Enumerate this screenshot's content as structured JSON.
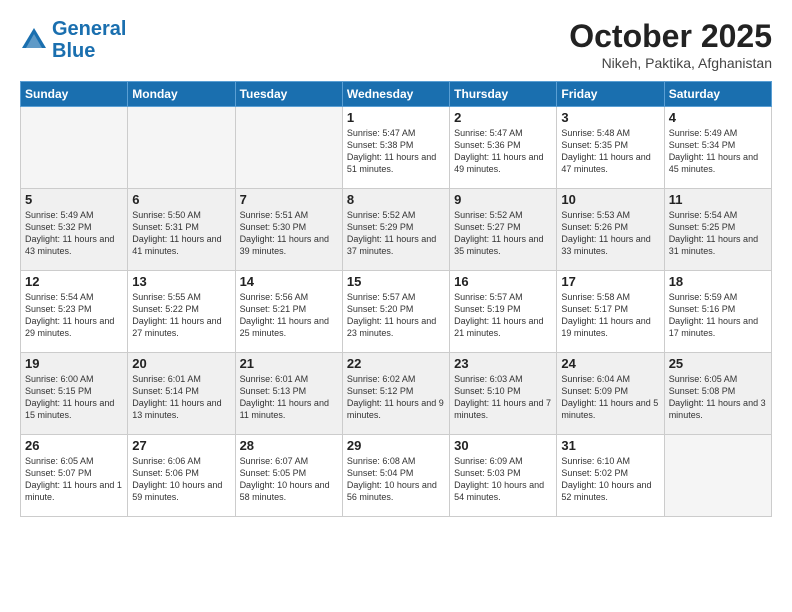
{
  "header": {
    "logo_line1": "General",
    "logo_line2": "Blue",
    "month": "October 2025",
    "location": "Nikeh, Paktika, Afghanistan"
  },
  "days_of_week": [
    "Sunday",
    "Monday",
    "Tuesday",
    "Wednesday",
    "Thursday",
    "Friday",
    "Saturday"
  ],
  "weeks": [
    [
      {
        "day": "",
        "text": ""
      },
      {
        "day": "",
        "text": ""
      },
      {
        "day": "",
        "text": ""
      },
      {
        "day": "1",
        "text": "Sunrise: 5:47 AM\nSunset: 5:38 PM\nDaylight: 11 hours\nand 51 minutes."
      },
      {
        "day": "2",
        "text": "Sunrise: 5:47 AM\nSunset: 5:36 PM\nDaylight: 11 hours\nand 49 minutes."
      },
      {
        "day": "3",
        "text": "Sunrise: 5:48 AM\nSunset: 5:35 PM\nDaylight: 11 hours\nand 47 minutes."
      },
      {
        "day": "4",
        "text": "Sunrise: 5:49 AM\nSunset: 5:34 PM\nDaylight: 11 hours\nand 45 minutes."
      }
    ],
    [
      {
        "day": "5",
        "text": "Sunrise: 5:49 AM\nSunset: 5:32 PM\nDaylight: 11 hours\nand 43 minutes."
      },
      {
        "day": "6",
        "text": "Sunrise: 5:50 AM\nSunset: 5:31 PM\nDaylight: 11 hours\nand 41 minutes."
      },
      {
        "day": "7",
        "text": "Sunrise: 5:51 AM\nSunset: 5:30 PM\nDaylight: 11 hours\nand 39 minutes."
      },
      {
        "day": "8",
        "text": "Sunrise: 5:52 AM\nSunset: 5:29 PM\nDaylight: 11 hours\nand 37 minutes."
      },
      {
        "day": "9",
        "text": "Sunrise: 5:52 AM\nSunset: 5:27 PM\nDaylight: 11 hours\nand 35 minutes."
      },
      {
        "day": "10",
        "text": "Sunrise: 5:53 AM\nSunset: 5:26 PM\nDaylight: 11 hours\nand 33 minutes."
      },
      {
        "day": "11",
        "text": "Sunrise: 5:54 AM\nSunset: 5:25 PM\nDaylight: 11 hours\nand 31 minutes."
      }
    ],
    [
      {
        "day": "12",
        "text": "Sunrise: 5:54 AM\nSunset: 5:23 PM\nDaylight: 11 hours\nand 29 minutes."
      },
      {
        "day": "13",
        "text": "Sunrise: 5:55 AM\nSunset: 5:22 PM\nDaylight: 11 hours\nand 27 minutes."
      },
      {
        "day": "14",
        "text": "Sunrise: 5:56 AM\nSunset: 5:21 PM\nDaylight: 11 hours\nand 25 minutes."
      },
      {
        "day": "15",
        "text": "Sunrise: 5:57 AM\nSunset: 5:20 PM\nDaylight: 11 hours\nand 23 minutes."
      },
      {
        "day": "16",
        "text": "Sunrise: 5:57 AM\nSunset: 5:19 PM\nDaylight: 11 hours\nand 21 minutes."
      },
      {
        "day": "17",
        "text": "Sunrise: 5:58 AM\nSunset: 5:17 PM\nDaylight: 11 hours\nand 19 minutes."
      },
      {
        "day": "18",
        "text": "Sunrise: 5:59 AM\nSunset: 5:16 PM\nDaylight: 11 hours\nand 17 minutes."
      }
    ],
    [
      {
        "day": "19",
        "text": "Sunrise: 6:00 AM\nSunset: 5:15 PM\nDaylight: 11 hours\nand 15 minutes."
      },
      {
        "day": "20",
        "text": "Sunrise: 6:01 AM\nSunset: 5:14 PM\nDaylight: 11 hours\nand 13 minutes."
      },
      {
        "day": "21",
        "text": "Sunrise: 6:01 AM\nSunset: 5:13 PM\nDaylight: 11 hours\nand 11 minutes."
      },
      {
        "day": "22",
        "text": "Sunrise: 6:02 AM\nSunset: 5:12 PM\nDaylight: 11 hours\nand 9 minutes."
      },
      {
        "day": "23",
        "text": "Sunrise: 6:03 AM\nSunset: 5:10 PM\nDaylight: 11 hours\nand 7 minutes."
      },
      {
        "day": "24",
        "text": "Sunrise: 6:04 AM\nSunset: 5:09 PM\nDaylight: 11 hours\nand 5 minutes."
      },
      {
        "day": "25",
        "text": "Sunrise: 6:05 AM\nSunset: 5:08 PM\nDaylight: 11 hours\nand 3 minutes."
      }
    ],
    [
      {
        "day": "26",
        "text": "Sunrise: 6:05 AM\nSunset: 5:07 PM\nDaylight: 11 hours\nand 1 minute."
      },
      {
        "day": "27",
        "text": "Sunrise: 6:06 AM\nSunset: 5:06 PM\nDaylight: 10 hours\nand 59 minutes."
      },
      {
        "day": "28",
        "text": "Sunrise: 6:07 AM\nSunset: 5:05 PM\nDaylight: 10 hours\nand 58 minutes."
      },
      {
        "day": "29",
        "text": "Sunrise: 6:08 AM\nSunset: 5:04 PM\nDaylight: 10 hours\nand 56 minutes."
      },
      {
        "day": "30",
        "text": "Sunrise: 6:09 AM\nSunset: 5:03 PM\nDaylight: 10 hours\nand 54 minutes."
      },
      {
        "day": "31",
        "text": "Sunrise: 6:10 AM\nSunset: 5:02 PM\nDaylight: 10 hours\nand 52 minutes."
      },
      {
        "day": "",
        "text": ""
      }
    ]
  ]
}
